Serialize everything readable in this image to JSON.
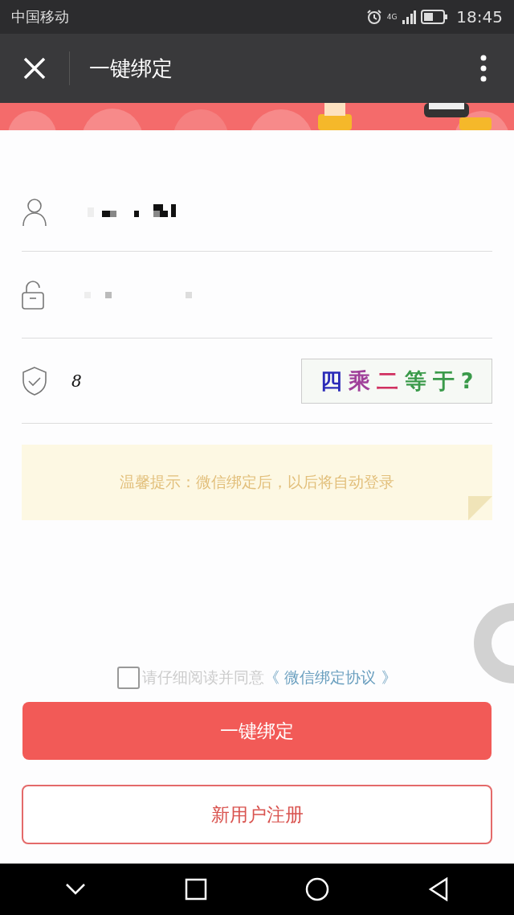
{
  "status_bar": {
    "carrier": "中国移动",
    "network": "4G",
    "time": "18:45"
  },
  "nav": {
    "title": "一键绑定"
  },
  "form": {
    "captcha_value": "8",
    "captcha_chars": [
      {
        "char": "四",
        "color": "#2a2ab8"
      },
      {
        "char": "乘",
        "color": "#a0409a"
      },
      {
        "char": "二",
        "color": "#d03060"
      },
      {
        "char": "等",
        "color": "#3a9a4a"
      },
      {
        "char": "于",
        "color": "#3a9a4a"
      },
      {
        "char": "?",
        "color": "#3a9a4a"
      }
    ]
  },
  "tip": "温馨提示：微信绑定后，以后将自动登录",
  "agreement": {
    "checked": false,
    "text": "请仔细阅读并同意",
    "link": "《 微信绑定协议 》"
  },
  "buttons": {
    "primary": "一键绑定",
    "secondary": "新用户注册"
  }
}
